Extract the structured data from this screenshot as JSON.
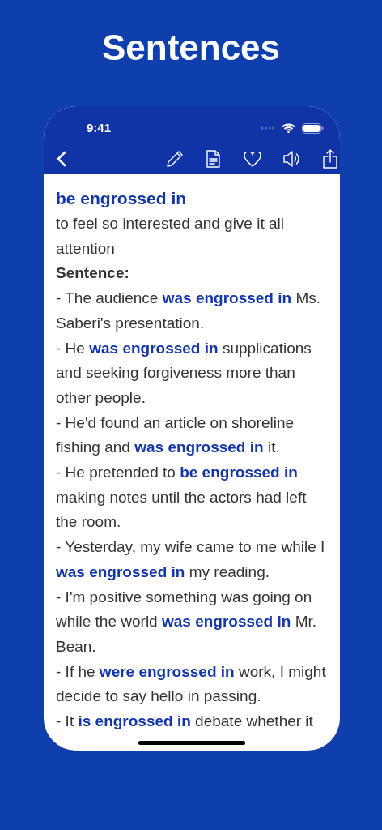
{
  "title": "Sentences",
  "status_bar": {
    "time": "9:41"
  },
  "toolbar": [
    {
      "kind": "back"
    },
    {
      "kind": "edit"
    },
    {
      "kind": "document"
    },
    {
      "kind": "favorite"
    },
    {
      "kind": "speaker"
    },
    {
      "kind": "share"
    }
  ],
  "entry": {
    "term": "be engrossed in",
    "definition": "to feel so interested and give it all attention",
    "section_label": "Sentence:",
    "sentences": [
      "- The audience **was engrossed in** Ms. Saberi's presentation.",
      "- He **was engrossed in** supplications and seeking forgiveness more than other people.",
      "- He'd found an article on shoreline fishing and **was engrossed in** it.",
      "- He pretended to **be engrossed in** making notes until the actors had left the room.",
      "- Yesterday, my wife came to me while I **was engrossed in** my reading.",
      "- I'm positive something was going on while the world **was engrossed in** Mr. Bean.",
      "- If he **were engrossed in** work, I might decide to say hello in passing.",
      "- It **is engrossed in** debate whether it"
    ]
  }
}
